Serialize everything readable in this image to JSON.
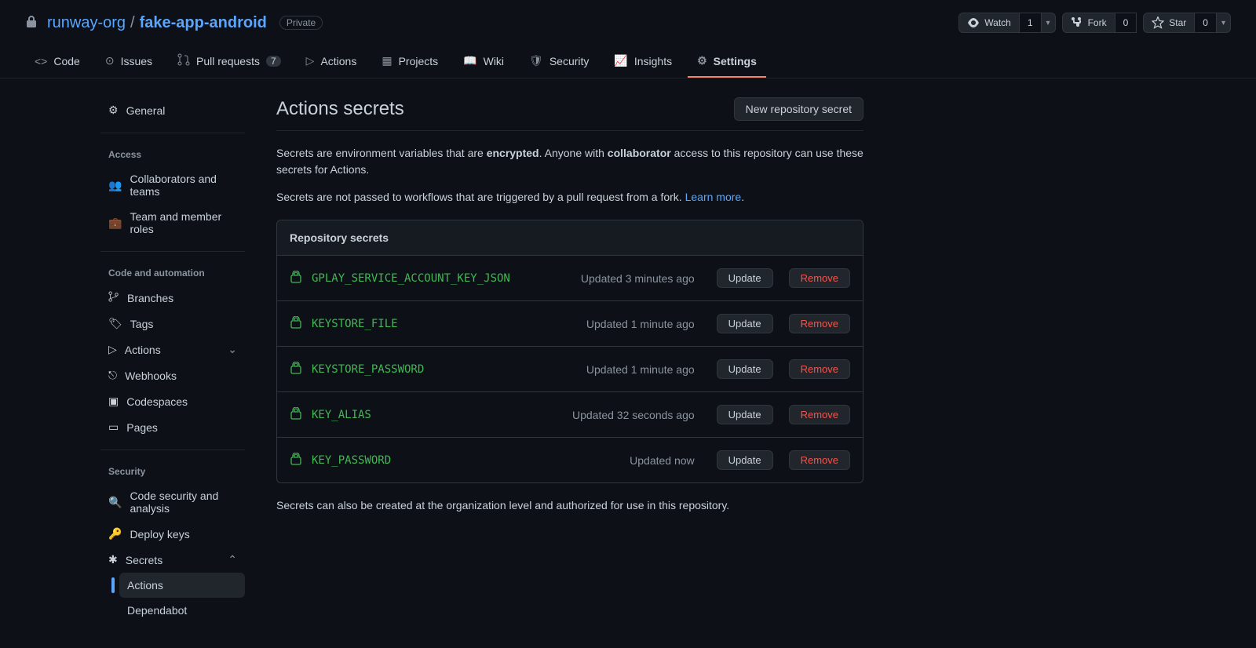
{
  "header": {
    "org": "runway-org",
    "repo": "fake-app-android",
    "visibility": "Private",
    "watch": {
      "label": "Watch",
      "count": "1"
    },
    "fork": {
      "label": "Fork",
      "count": "0"
    },
    "star": {
      "label": "Star",
      "count": "0"
    }
  },
  "tabs": {
    "code": "Code",
    "issues": "Issues",
    "pulls": "Pull requests",
    "pulls_count": "7",
    "actions": "Actions",
    "projects": "Projects",
    "wiki": "Wiki",
    "security": "Security",
    "insights": "Insights",
    "settings": "Settings"
  },
  "sidebar": {
    "general": "General",
    "access_heading": "Access",
    "collaborators": "Collaborators and teams",
    "team_roles": "Team and member roles",
    "automation_heading": "Code and automation",
    "branches": "Branches",
    "tags": "Tags",
    "actions": "Actions",
    "webhooks": "Webhooks",
    "codespaces": "Codespaces",
    "pages": "Pages",
    "security_heading": "Security",
    "code_security": "Code security and analysis",
    "deploy_keys": "Deploy keys",
    "secrets": "Secrets",
    "secrets_actions": "Actions",
    "secrets_dependabot": "Dependabot"
  },
  "page": {
    "title": "Actions secrets",
    "new_button": "New repository secret",
    "desc_pre": "Secrets are environment variables that are ",
    "desc_encrypted": "encrypted",
    "desc_mid": ". Anyone with ",
    "desc_collab": "collaborator",
    "desc_post": " access to this repository can use these secrets for Actions.",
    "desc_fork": "Secrets are not passed to workflows that are triggered by a pull request from a fork. ",
    "learn_more": "Learn more",
    "dot": ".",
    "repo_secrets_heading": "Repository secrets",
    "update": "Update",
    "remove": "Remove",
    "footer": "Secrets can also be created at the organization level and authorized for use in this repository."
  },
  "secrets": [
    {
      "name": "GPLAY_SERVICE_ACCOUNT_KEY_JSON",
      "updated": "Updated 3 minutes ago"
    },
    {
      "name": "KEYSTORE_FILE",
      "updated": "Updated 1 minute ago"
    },
    {
      "name": "KEYSTORE_PASSWORD",
      "updated": "Updated 1 minute ago"
    },
    {
      "name": "KEY_ALIAS",
      "updated": "Updated 32 seconds ago"
    },
    {
      "name": "KEY_PASSWORD",
      "updated": "Updated now"
    }
  ]
}
